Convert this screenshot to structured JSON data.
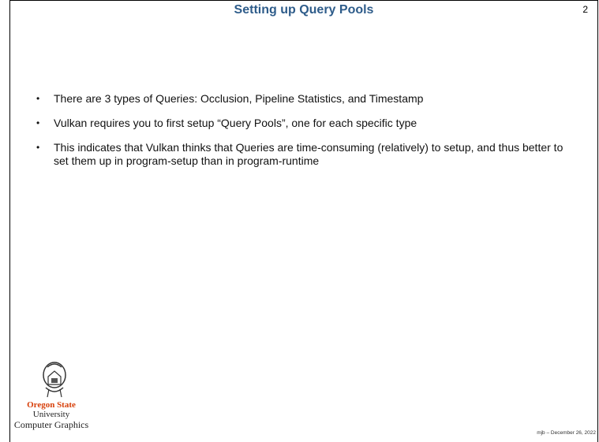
{
  "slide": {
    "title": "Setting up Query Pools",
    "number": "2",
    "bullets": [
      "There are 3 types of Queries: Occlusion, Pipeline Statistics, and Timestamp",
      "Vulkan requires you to first setup “Query Pools”, one for each specific type",
      "This indicates that Vulkan thinks that Queries are time-consuming (relatively) to setup, and thus better to set them up in program-setup than in program-runtime"
    ],
    "footer": "mjb – December 26, 2022"
  },
  "logo": {
    "line1": "Oregon State",
    "line2": "University",
    "line3": "Computer Graphics"
  },
  "colors": {
    "title": "#2e5c8a",
    "osu_orange": "#d73f09"
  }
}
